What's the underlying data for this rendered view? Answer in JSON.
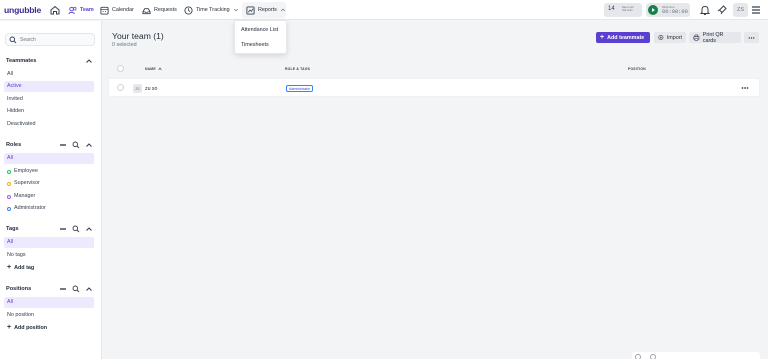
{
  "brand": {
    "name": "ungubble"
  },
  "nav": {
    "team": "Team",
    "calendar": "Calendar",
    "requests": "Requests",
    "time_tracking": "Time Tracking",
    "reports": "Reports"
  },
  "reports_menu": {
    "items": [
      "Attendance List",
      "Timesheets"
    ]
  },
  "header": {
    "days_count": "14",
    "days_label_1": "Days until",
    "days_label_2": "trial ends",
    "timer_label": "Work time",
    "timer_value": "00:00:00",
    "avatar": "ZS"
  },
  "sidebar": {
    "search_placeholder": "Search",
    "teammates": {
      "title": "Teammates",
      "items": [
        "All",
        "Active",
        "Invited",
        "Hidden",
        "Deactivated"
      ],
      "selected": "Active"
    },
    "roles": {
      "title": "Roles",
      "items": [
        "All",
        "Employee",
        "Supervisor",
        "Manager",
        "Administrator"
      ],
      "selected": "All"
    },
    "tags": {
      "title": "Tags",
      "items": [
        "All",
        "No tags"
      ],
      "add": "Add tag",
      "selected": "All"
    },
    "positions": {
      "title": "Positions",
      "items": [
        "All",
        "No position"
      ],
      "add": "Add position",
      "selected": "All"
    }
  },
  "main": {
    "title": "Your team (1)",
    "subtitle": "0 selected",
    "buttons": {
      "add": "Add teammate",
      "import": "Import",
      "print": "Print QR cards"
    },
    "table": {
      "headers": {
        "name": "NAME",
        "role_tags": "ROLE & TAGS",
        "position": "POSITION"
      },
      "rows": [
        {
          "initials": "ZS",
          "name": "zu so",
          "role": "Administrator"
        }
      ]
    }
  },
  "colors": {
    "accent": "#5b3fd0",
    "brand_text": "#3b2c8f",
    "play_button": "#14804a"
  }
}
